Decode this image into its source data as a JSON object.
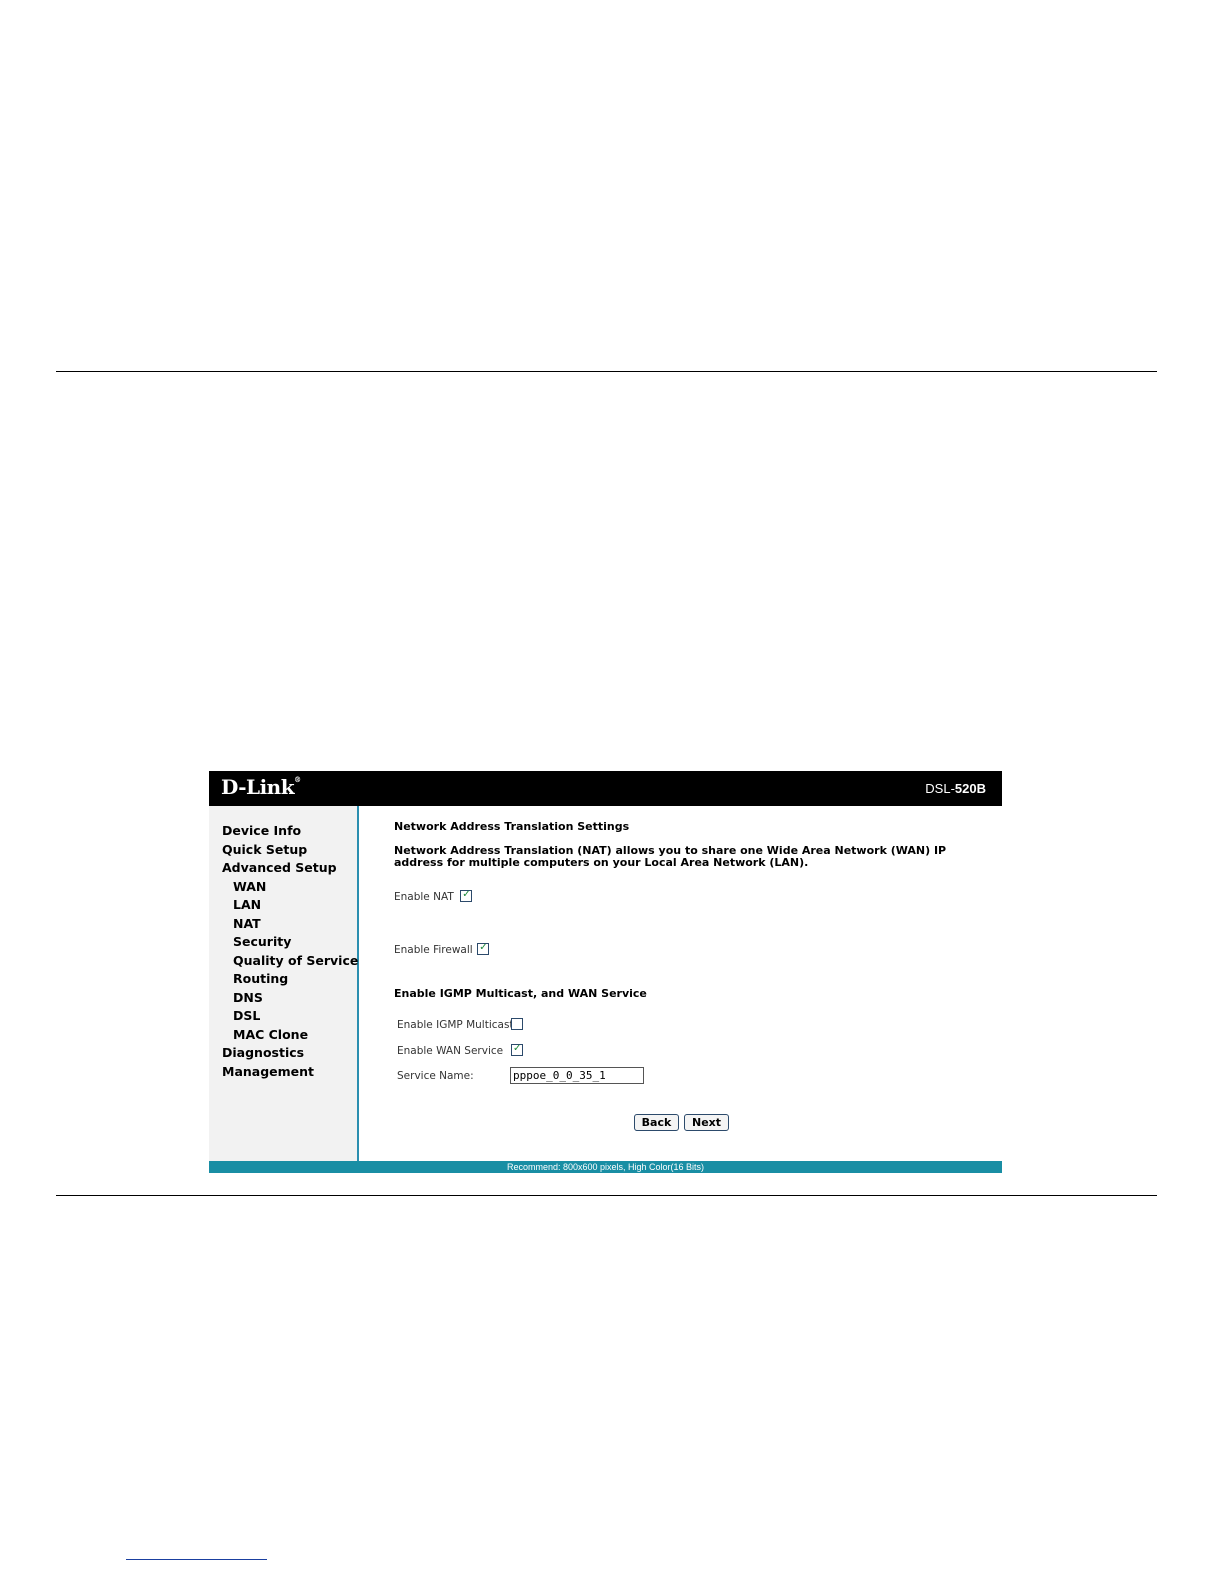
{
  "header": {
    "logo": "D-Link",
    "model_prefix": "DSL-",
    "model_number": "520B"
  },
  "sidebar": {
    "items": [
      {
        "label": "Device Info",
        "level": 0
      },
      {
        "label": "Quick Setup",
        "level": 0
      },
      {
        "label": "Advanced Setup",
        "level": 0
      },
      {
        "label": "WAN",
        "level": 1
      },
      {
        "label": "LAN",
        "level": 1
      },
      {
        "label": "NAT",
        "level": 1
      },
      {
        "label": "Security",
        "level": 1
      },
      {
        "label": "Quality of Service",
        "level": 1
      },
      {
        "label": "Routing",
        "level": 1
      },
      {
        "label": "DNS",
        "level": 1
      },
      {
        "label": "DSL",
        "level": 1
      },
      {
        "label": "MAC Clone",
        "level": 1
      },
      {
        "label": "Diagnostics",
        "level": 0
      },
      {
        "label": "Management",
        "level": 0
      }
    ]
  },
  "main": {
    "title": "Network Address Translation Settings",
    "description": "Network Address Translation (NAT) allows you to share one Wide Area Network (WAN) IP address for multiple computers on your Local Area Network (LAN).",
    "enable_nat": {
      "label": "Enable NAT",
      "checked": true
    },
    "enable_firewall": {
      "label": "Enable Firewall",
      "checked": true
    },
    "igmp_heading": "Enable IGMP Multicast, and WAN Service",
    "enable_igmp": {
      "label": "Enable IGMP Multicast",
      "checked": false
    },
    "enable_wan_service": {
      "label": "Enable WAN Service",
      "checked": true
    },
    "service_name": {
      "label": "Service Name:",
      "value": "pppoe_0_0_35_1"
    },
    "back_label": "Back",
    "next_label": "Next"
  },
  "footer": {
    "status_text": "Recommend: 800x600 pixels, High Color(16 Bits)"
  },
  "colors": {
    "banner": "#000000",
    "sidebar_bg": "#f2f2f2",
    "accent": "#198ea4",
    "check": "#1d8a3a"
  },
  "icons": {
    "checkmark": "check-icon"
  }
}
